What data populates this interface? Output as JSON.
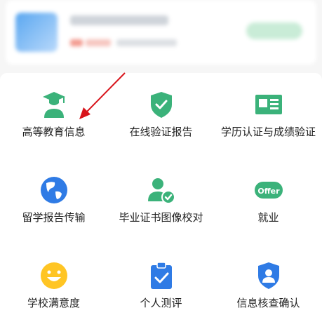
{
  "services": [
    {
      "label": "高等教育信息",
      "icon": "graduate-icon"
    },
    {
      "label": "在线验证报告",
      "icon": "shield-check-icon"
    },
    {
      "label": "学历认证与成绩验证",
      "icon": "id-card-icon"
    },
    {
      "label": "留学报告传输",
      "icon": "globe-icon"
    },
    {
      "label": "毕业证书图像校对",
      "icon": "user-check-icon"
    },
    {
      "label": "就业",
      "icon": "offer-badge-icon",
      "badge_text": "Offer"
    },
    {
      "label": "学校满意度",
      "icon": "smiley-icon"
    },
    {
      "label": "个人测评",
      "icon": "clipboard-check-icon"
    },
    {
      "label": "信息核查确认",
      "icon": "user-badge-icon"
    }
  ],
  "colors": {
    "green": "#3bb27a",
    "blue": "#2f7be5",
    "yellow": "#ffc524",
    "arrow": "#d8141b"
  }
}
